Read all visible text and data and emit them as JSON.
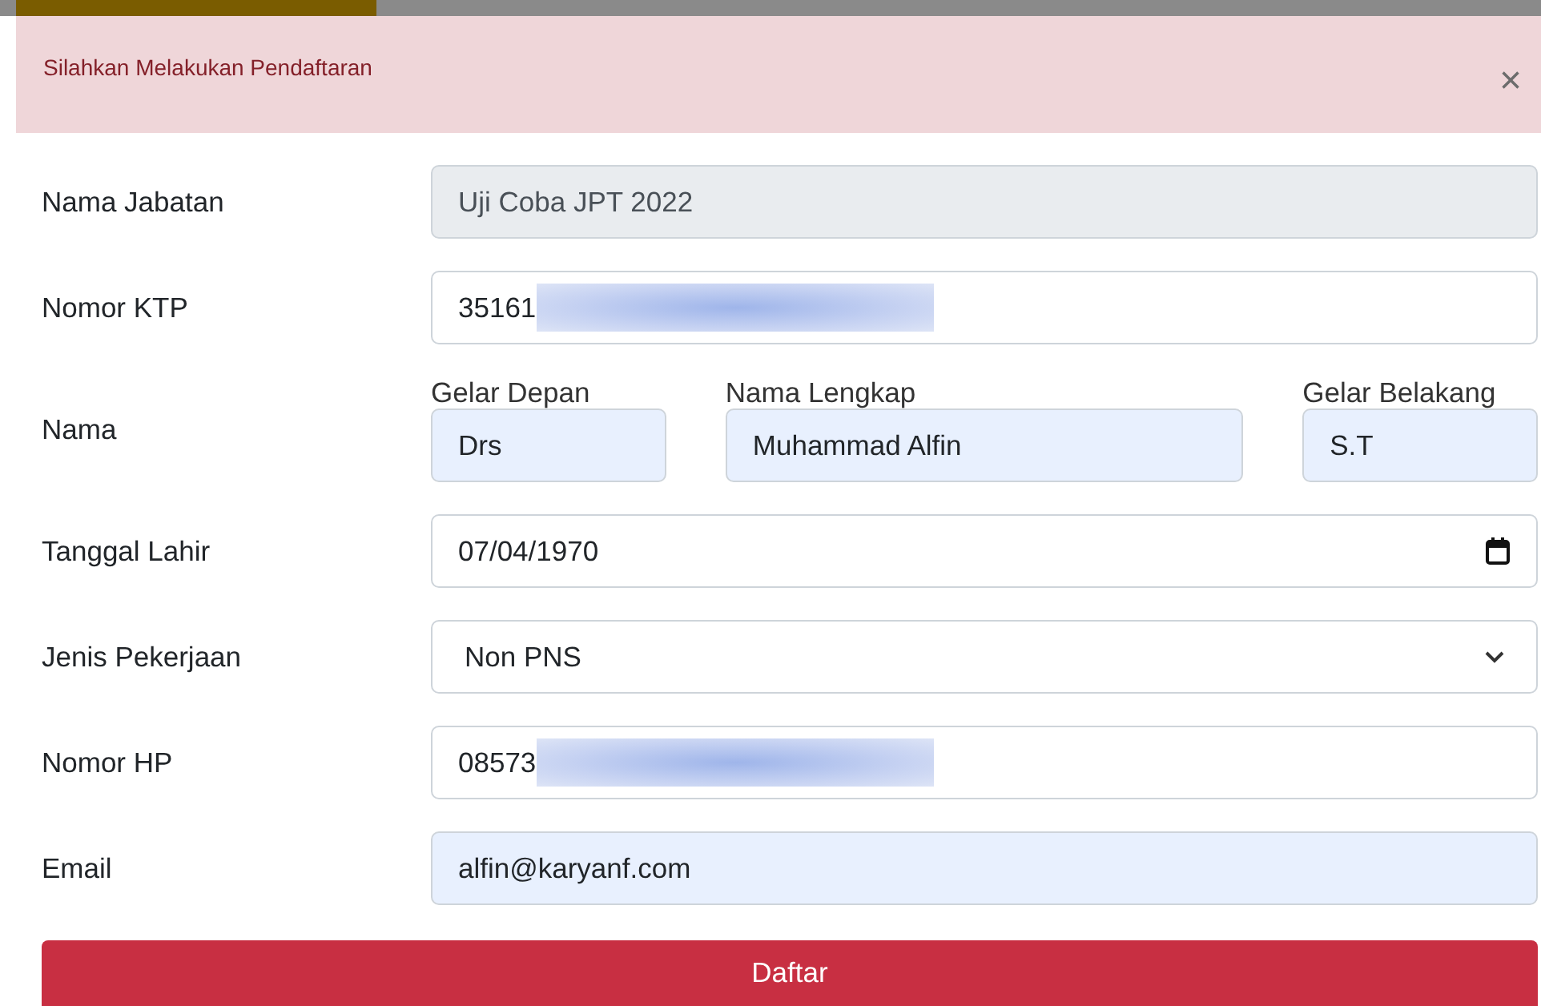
{
  "alert": {
    "message": "Silahkan Melakukan Pendaftaran",
    "close": "×"
  },
  "form": {
    "rows": [
      {
        "label": "Nama Jabatan",
        "fields": [
          {
            "kind": "text",
            "value": "Uji Coba JPT 2022",
            "readonly": true
          }
        ]
      },
      {
        "label": "Nomor KTP",
        "fields": [
          {
            "kind": "text",
            "value": "35161",
            "readonly": false,
            "autofilled": false,
            "redacted": true
          }
        ]
      },
      {
        "label": "Nama",
        "fields": [
          {
            "kind": "text",
            "caption": "Gelar Depan",
            "value": "Drs",
            "readonly": false,
            "autofilled": true
          },
          {
            "kind": "text",
            "caption": "Nama Lengkap",
            "value": "Muhammad Alfin",
            "readonly": false,
            "autofilled": true
          },
          {
            "kind": "text",
            "caption": "Gelar Belakang",
            "value": "S.T",
            "readonly": false,
            "autofilled": true
          }
        ]
      },
      {
        "label": "Tanggal Lahir",
        "fields": [
          {
            "kind": "date",
            "value": "07/04/1970",
            "readonly": false,
            "autofilled": false
          }
        ]
      },
      {
        "label": "Jenis Pekerjaan",
        "fields": [
          {
            "kind": "select",
            "value": "Non PNS",
            "readonly": false,
            "autofilled": false
          }
        ]
      },
      {
        "label": "Nomor HP",
        "fields": [
          {
            "kind": "text",
            "value": "08573",
            "readonly": false,
            "autofilled": false,
            "redacted": true
          }
        ]
      },
      {
        "label": "Email",
        "fields": [
          {
            "kind": "text",
            "value": "alfin@karyanf.com",
            "readonly": false,
            "autofilled": true
          }
        ]
      }
    ],
    "submit": "Daftar"
  }
}
